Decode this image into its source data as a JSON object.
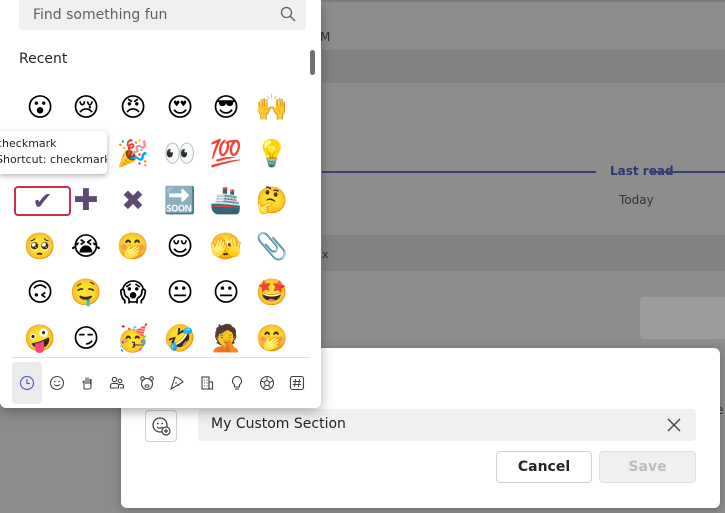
{
  "background": {
    "time_fragment": "M",
    "last_read": "Last read",
    "today": "Today",
    "x_fragment": "x",
    "e_fragment": "e"
  },
  "picker": {
    "search_placeholder": "Find something fun",
    "section_title": "Recent",
    "tooltip_line1": "checkmark",
    "tooltip_line2": "Shortcut: checkmark",
    "emojis": [
      [
        "😮",
        "😢",
        "😠",
        "😍",
        "😎",
        "🙌"
      ],
      [
        "",
        "",
        "🎉",
        "👀",
        "💯",
        "💡"
      ],
      [
        "✔",
        "✚",
        "✖",
        "🔜",
        "🚢",
        "🤔"
      ],
      [
        "🥺",
        "😭",
        "🤭",
        "😌",
        "🫣",
        "📎"
      ],
      [
        "🙃",
        "🤤",
        "😱",
        "😐",
        "😐",
        "🤩"
      ],
      [
        "🤪",
        "😏",
        "🥳",
        "🤣",
        "🤦",
        "🤭"
      ]
    ],
    "categories": [
      "clock-icon",
      "smiley-icon",
      "hand-icon",
      "people-icon",
      "animal-icon",
      "food-icon",
      "building-icon",
      "lightbulb-icon",
      "ball-icon",
      "hashtag-icon"
    ]
  },
  "dialog": {
    "section_name": "My Custom Section",
    "cancel_label": "Cancel",
    "save_label": "Save"
  }
}
